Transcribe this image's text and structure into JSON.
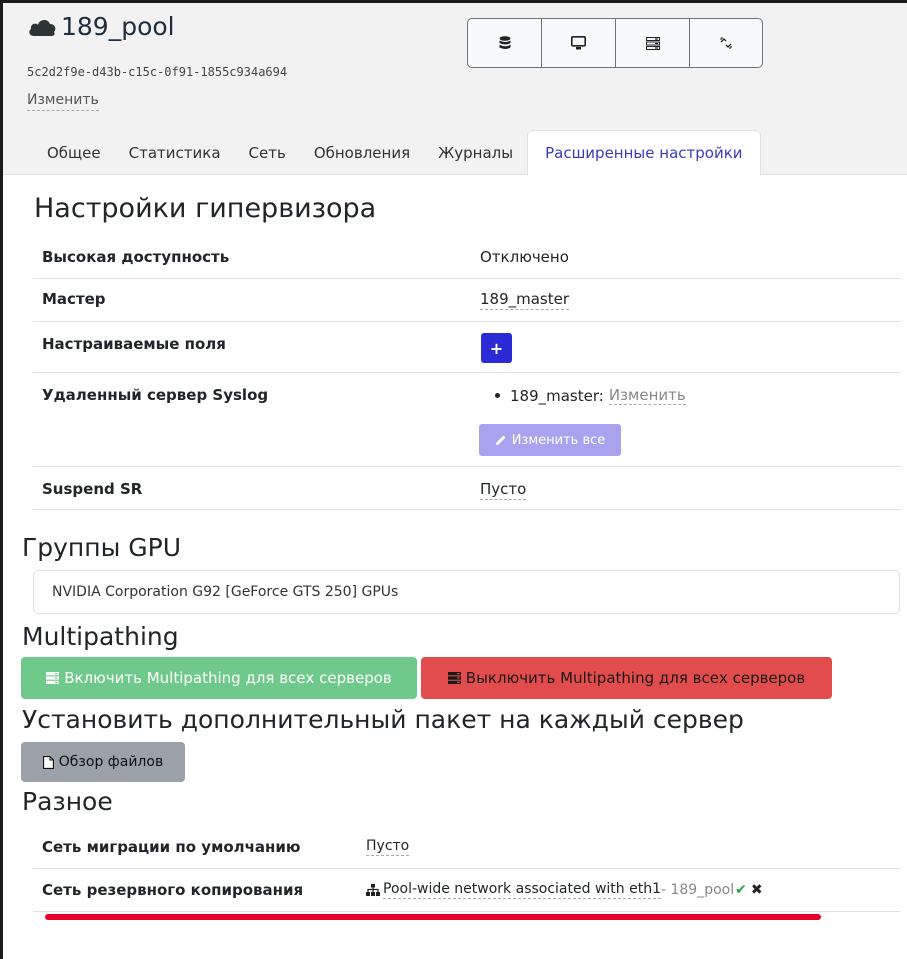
{
  "header": {
    "pool_name": "189_pool",
    "uuid": "5c2d2f9e-d43b-c15c-0f91-1855c934a694",
    "edit_label": "Изменить",
    "action_icons": [
      "database-icon",
      "monitor-icon",
      "server-icon",
      "unlink-icon"
    ]
  },
  "tabs": [
    {
      "label": "Общее"
    },
    {
      "label": "Статистика"
    },
    {
      "label": "Сеть"
    },
    {
      "label": "Обновления"
    },
    {
      "label": "Журналы"
    },
    {
      "label": "Расширенные настройки",
      "active": true
    }
  ],
  "hypervisor": {
    "title": "Настройки гипервизора",
    "high_availability": {
      "label": "Высокая доступность",
      "value": "Отключено"
    },
    "master": {
      "label": "Мастер",
      "value": "189_master"
    },
    "custom_fields": {
      "label": "Настраиваемые поля",
      "button": "+"
    },
    "syslog": {
      "label": "Удаленный сервер Syslog",
      "host": "189_master:",
      "change": "Изменить",
      "edit_all": "Изменить все"
    },
    "suspend_sr": {
      "label": "Suspend SR",
      "value": "Пусто"
    }
  },
  "gpu": {
    "title": "Группы GPU",
    "group": "NVIDIA Corporation G92 [GeForce GTS 250] GPUs"
  },
  "multipathing": {
    "title": "Multipathing",
    "enable_label": "Включить Multipathing для всех серверов",
    "disable_label": "Выключить Multipathing для всех серверов"
  },
  "package": {
    "title": "Установить дополнительный пакет на каждый сервер",
    "browse_label": "Обзор файлов"
  },
  "misc": {
    "title": "Разное",
    "migration": {
      "label": "Сеть миграции по умолчанию",
      "value": "Пусто"
    },
    "backup": {
      "label": "Сеть резервного копирования",
      "network": "Pool-wide network associated with eth1",
      "pool": " - 189_pool"
    }
  },
  "colors": {
    "primary": "#2b2bd6",
    "primary_disabled": "#a9a3ef",
    "success": "#6fc98a",
    "danger": "#e24c4c",
    "secondary": "#9aa1a8",
    "highlight_underline": "#e8002b"
  }
}
